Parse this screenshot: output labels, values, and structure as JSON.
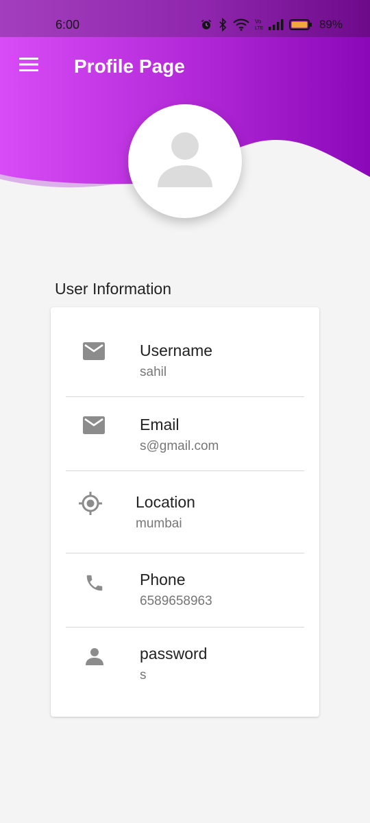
{
  "status_bar": {
    "time": "6:00",
    "battery_percent": "89%",
    "icons": [
      "alarm-icon",
      "bluetooth-icon",
      "wifi-icon",
      "volte-icon",
      "signal-icon",
      "battery-icon"
    ]
  },
  "app_bar": {
    "menu_icon": "menu-icon",
    "title": "Profile Page"
  },
  "avatar": {
    "icon": "person-icon"
  },
  "user_info": {
    "section_title": "User Information",
    "items": [
      {
        "icon": "mail-icon",
        "label": "Username",
        "value": "sahil"
      },
      {
        "icon": "mail-icon",
        "label": "Email",
        "value": "s@gmail.com"
      },
      {
        "icon": "location-target-icon",
        "label": "Location",
        "value": "mumbai"
      },
      {
        "icon": "phone-icon",
        "label": "Phone",
        "value": "6589658963"
      },
      {
        "icon": "person-icon",
        "label": "password",
        "value": "s"
      }
    ]
  },
  "colors": {
    "header_gradient_start": "#d84cf6",
    "header_gradient_end": "#8a08b8",
    "battery_fill": "#f2a93b",
    "icon_gray": "#8c8c8c"
  }
}
